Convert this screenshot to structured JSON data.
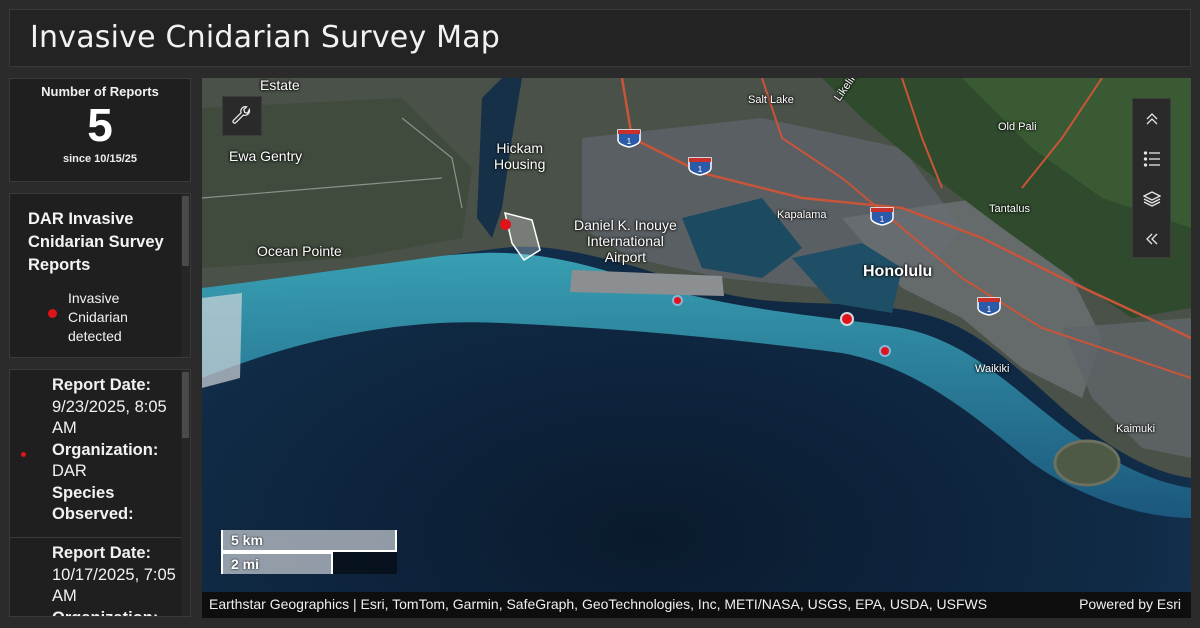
{
  "header": {
    "title": "Invasive Cnidarian Survey Map"
  },
  "summary": {
    "title": "Number of Reports",
    "value": "5",
    "subtitle": "since 10/15/25"
  },
  "legend": {
    "title": "DAR Invasive Cnidarian Survey Reports",
    "items": [
      {
        "label": "Invasive Cnidarian detected",
        "color": "#e0131a"
      }
    ]
  },
  "reports": [
    {
      "date_label": "Report Date:",
      "date": "9/23/2025, 8:05 AM",
      "org_label": "Organization:",
      "org": "DAR",
      "species_label": "Species Observed:"
    },
    {
      "date_label": "Report Date:",
      "date": "10/17/2025, 7:05 AM",
      "org_label": "Organization:"
    }
  ],
  "map": {
    "places": {
      "estate": "Estate",
      "ewa_gentry": "Ewa Gentry",
      "ocean_pointe": "Ocean Pointe",
      "hickam": "Hickam\nHousing",
      "airport": "Daniel K. Inouye\nInternational\nAirport",
      "salt_lake": "Salt Lake",
      "likelike": "Likelike Hwy",
      "old_pali": "Old Pali",
      "kapalama": "Kapalama",
      "tantalus": "Tantalus",
      "honolulu": "Honolulu",
      "waikiki": "Waikiki",
      "kaimuki": "Kaimuki"
    },
    "shield_label": "1",
    "scale": {
      "km": "5 km",
      "mi": "2 mi"
    },
    "attribution": "Earthstar Geographics | Esri, TomTom, Garmin, SafeGraph, GeoTechnologies, Inc, METI/NASA, USGS, EPA, USDA, USFWS",
    "powered_by": "Powered by Esri",
    "marker_color": "#e0131a"
  },
  "icons": {
    "tools": "wrench-icon",
    "collapse": "chevrons-up-icon",
    "legend": "list-icon",
    "layers": "layers-icon",
    "expand": "chevrons-left-icon"
  }
}
